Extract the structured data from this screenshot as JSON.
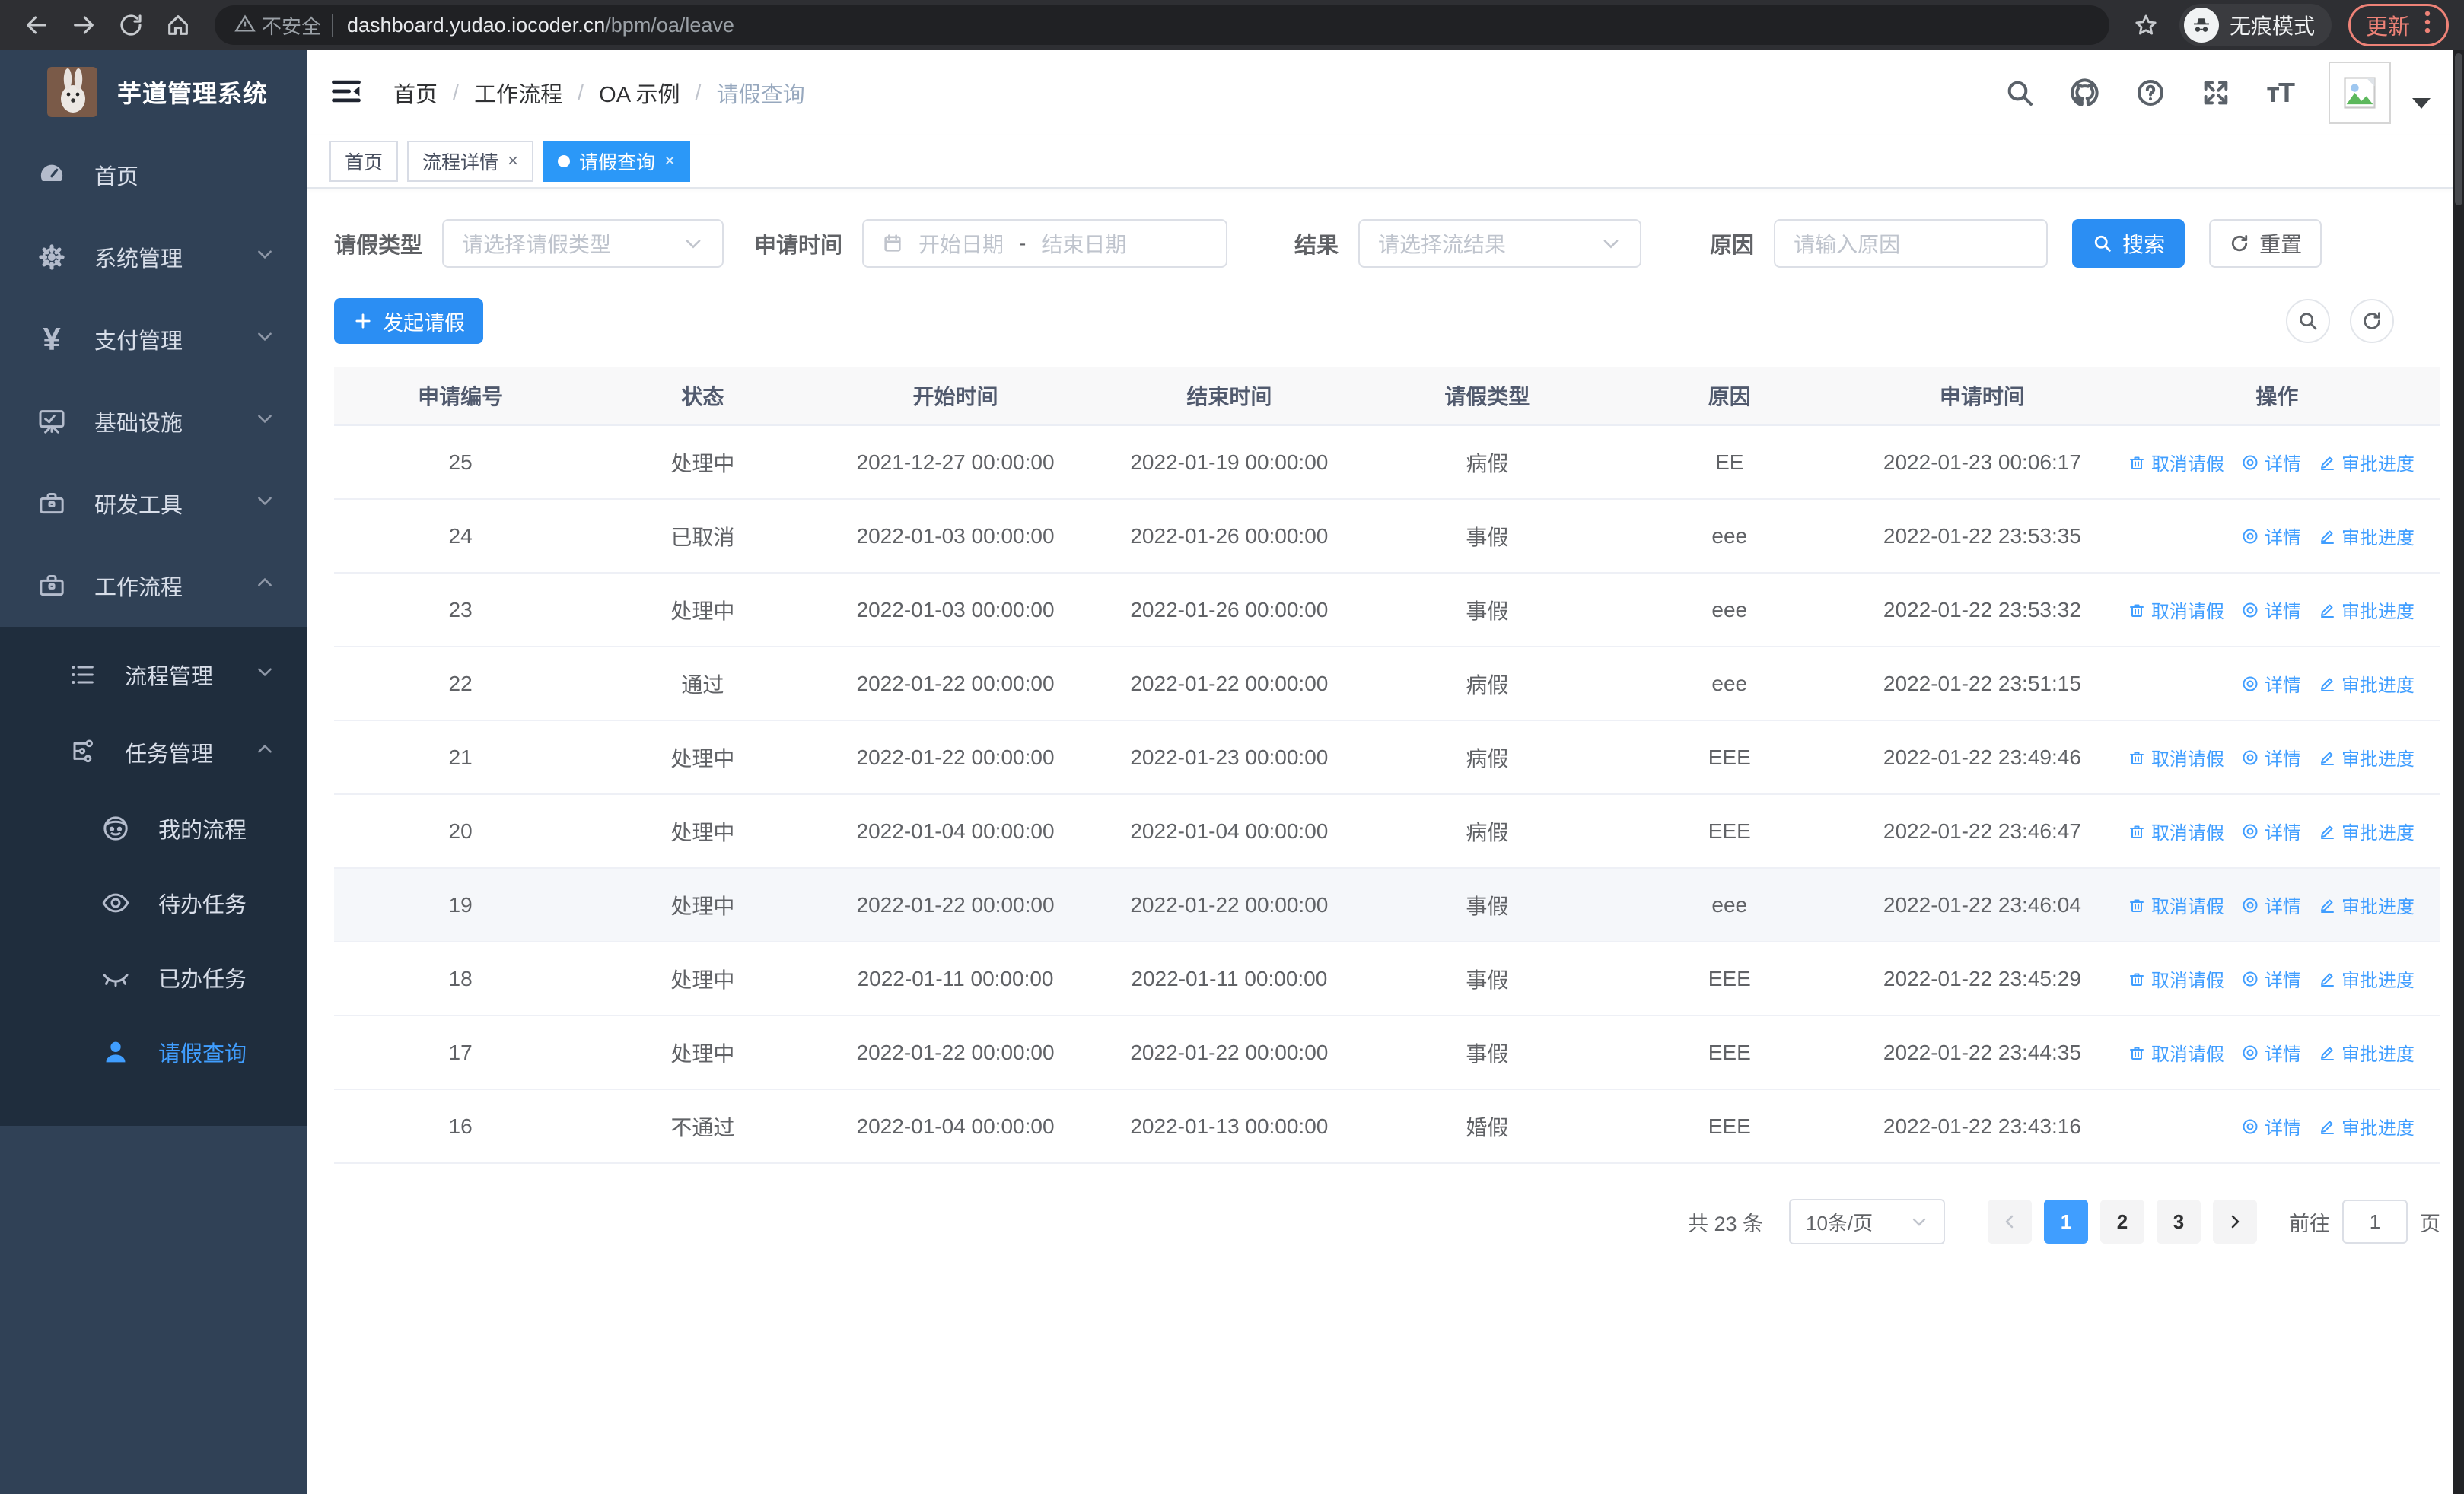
{
  "browser": {
    "security_label": "不安全",
    "url_host": "dashboard.yudao.iocoder.cn",
    "url_path": "/bpm/oa/leave",
    "incognito_label": "无痕模式",
    "update_label": "更新"
  },
  "colors": {
    "accent": "#409eff",
    "sidebar_bg": "#304156",
    "submenu_bg": "#1f2d3d",
    "update_badge": "#ee8277"
  },
  "sidebar": {
    "app_title": "芋道管理系统",
    "items": [
      {
        "label": "首页"
      },
      {
        "label": "系统管理"
      },
      {
        "label": "支付管理"
      },
      {
        "label": "基础设施"
      },
      {
        "label": "研发工具"
      },
      {
        "label": "工作流程"
      }
    ],
    "submenu": [
      {
        "label": "流程管理"
      },
      {
        "label": "任务管理"
      },
      {
        "label": "我的流程"
      },
      {
        "label": "待办任务"
      },
      {
        "label": "已办任务"
      },
      {
        "label": "请假查询"
      }
    ]
  },
  "breadcrumb": {
    "items": [
      "首页",
      "工作流程",
      "OA 示例",
      "请假查询"
    ]
  },
  "tabs": [
    {
      "label": "首页"
    },
    {
      "label": "流程详情"
    },
    {
      "label": "请假查询"
    }
  ],
  "filters": {
    "leave_type_label": "请假类型",
    "leave_type_placeholder": "请选择请假类型",
    "apply_time_label": "申请时间",
    "start_date_placeholder": "开始日期",
    "date_separator": "-",
    "end_date_placeholder": "结束日期",
    "result_label": "结果",
    "result_placeholder": "请选择流结果",
    "reason_label": "原因",
    "reason_placeholder": "请输入原因",
    "search_label": "搜索",
    "reset_label": "重置"
  },
  "toolbar": {
    "create_label": "发起请假"
  },
  "table": {
    "columns": [
      "申请编号",
      "状态",
      "开始时间",
      "结束时间",
      "请假类型",
      "原因",
      "申请时间",
      "操作"
    ],
    "rows": [
      {
        "id": "25",
        "status": "处理中",
        "start": "2021-12-27 00:00:00",
        "end": "2022-01-19 00:00:00",
        "type": "病假",
        "reason": "EE",
        "applied": "2022-01-23 00:06:17",
        "actions": [
          "cancel",
          "detail",
          "progress"
        ],
        "highlight": false
      },
      {
        "id": "24",
        "status": "已取消",
        "start": "2022-01-03 00:00:00",
        "end": "2022-01-26 00:00:00",
        "type": "事假",
        "reason": "eee",
        "applied": "2022-01-22 23:53:35",
        "actions": [
          "detail",
          "progress"
        ],
        "highlight": false
      },
      {
        "id": "23",
        "status": "处理中",
        "start": "2022-01-03 00:00:00",
        "end": "2022-01-26 00:00:00",
        "type": "事假",
        "reason": "eee",
        "applied": "2022-01-22 23:53:32",
        "actions": [
          "cancel",
          "detail",
          "progress"
        ],
        "highlight": false
      },
      {
        "id": "22",
        "status": "通过",
        "start": "2022-01-22 00:00:00",
        "end": "2022-01-22 00:00:00",
        "type": "病假",
        "reason": "eee",
        "applied": "2022-01-22 23:51:15",
        "actions": [
          "detail",
          "progress"
        ],
        "highlight": false
      },
      {
        "id": "21",
        "status": "处理中",
        "start": "2022-01-22 00:00:00",
        "end": "2022-01-23 00:00:00",
        "type": "病假",
        "reason": "EEE",
        "applied": "2022-01-22 23:49:46",
        "actions": [
          "cancel",
          "detail",
          "progress"
        ],
        "highlight": false
      },
      {
        "id": "20",
        "status": "处理中",
        "start": "2022-01-04 00:00:00",
        "end": "2022-01-04 00:00:00",
        "type": "病假",
        "reason": "EEE",
        "applied": "2022-01-22 23:46:47",
        "actions": [
          "cancel",
          "detail",
          "progress"
        ],
        "highlight": false
      },
      {
        "id": "19",
        "status": "处理中",
        "start": "2022-01-22 00:00:00",
        "end": "2022-01-22 00:00:00",
        "type": "事假",
        "reason": "eee",
        "applied": "2022-01-22 23:46:04",
        "actions": [
          "cancel",
          "detail",
          "progress"
        ],
        "highlight": true
      },
      {
        "id": "18",
        "status": "处理中",
        "start": "2022-01-11 00:00:00",
        "end": "2022-01-11 00:00:00",
        "type": "事假",
        "reason": "EEE",
        "applied": "2022-01-22 23:45:29",
        "actions": [
          "cancel",
          "detail",
          "progress"
        ],
        "highlight": false
      },
      {
        "id": "17",
        "status": "处理中",
        "start": "2022-01-22 00:00:00",
        "end": "2022-01-22 00:00:00",
        "type": "事假",
        "reason": "EEE",
        "applied": "2022-01-22 23:44:35",
        "actions": [
          "cancel",
          "detail",
          "progress"
        ],
        "highlight": false
      },
      {
        "id": "16",
        "status": "不通过",
        "start": "2022-01-04 00:00:00",
        "end": "2022-01-13 00:00:00",
        "type": "婚假",
        "reason": "EEE",
        "applied": "2022-01-22 23:43:16",
        "actions": [
          "detail",
          "progress"
        ],
        "highlight": false
      }
    ]
  },
  "action_labels": {
    "cancel": "取消请假",
    "detail": "详情",
    "progress": "审批进度"
  },
  "pagination": {
    "total_label": "共 23 条",
    "page_size": "10条/页",
    "pages": [
      "1",
      "2",
      "3"
    ],
    "active_page": "1",
    "goto_label": "前往",
    "goto_value": "1",
    "page_unit": "页"
  }
}
